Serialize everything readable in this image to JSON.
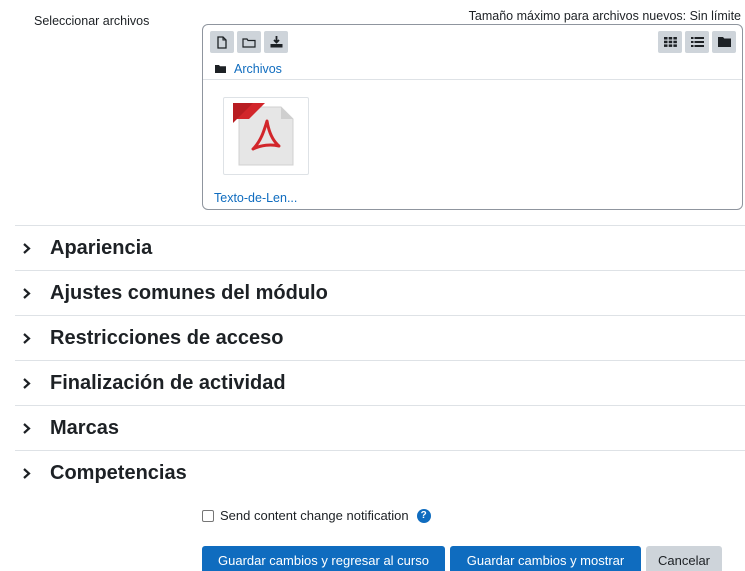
{
  "filepicker": {
    "label": "Seleccionar archivos",
    "max_size": "Tamaño máximo para archivos nuevos: Sin límite",
    "path": "Archivos",
    "toolbar_icons": [
      "new-file-icon",
      "new-folder-icon",
      "download-icon"
    ],
    "view_icons": [
      "grid-view-icon",
      "list-view-icon",
      "folder-tree-icon"
    ],
    "files": [
      {
        "name": "Texto-de-Len...",
        "icon": "pdf-icon"
      }
    ]
  },
  "sections": [
    {
      "title": "Apariencia"
    },
    {
      "title": "Ajustes comunes del módulo"
    },
    {
      "title": "Restricciones de acceso"
    },
    {
      "title": "Finalización de actividad"
    },
    {
      "title": "Marcas"
    },
    {
      "title": "Competencias"
    }
  ],
  "notification": {
    "label": "Send content change notification",
    "checked": false
  },
  "buttons": {
    "save_return": "Guardar cambios y regresar al curso",
    "save_display": "Guardar cambios y mostrar",
    "cancel": "Cancelar"
  },
  "colors": {
    "accent": "#0f6cbf",
    "secondary": "#ced4da",
    "pdf_red": "#d2262b"
  }
}
